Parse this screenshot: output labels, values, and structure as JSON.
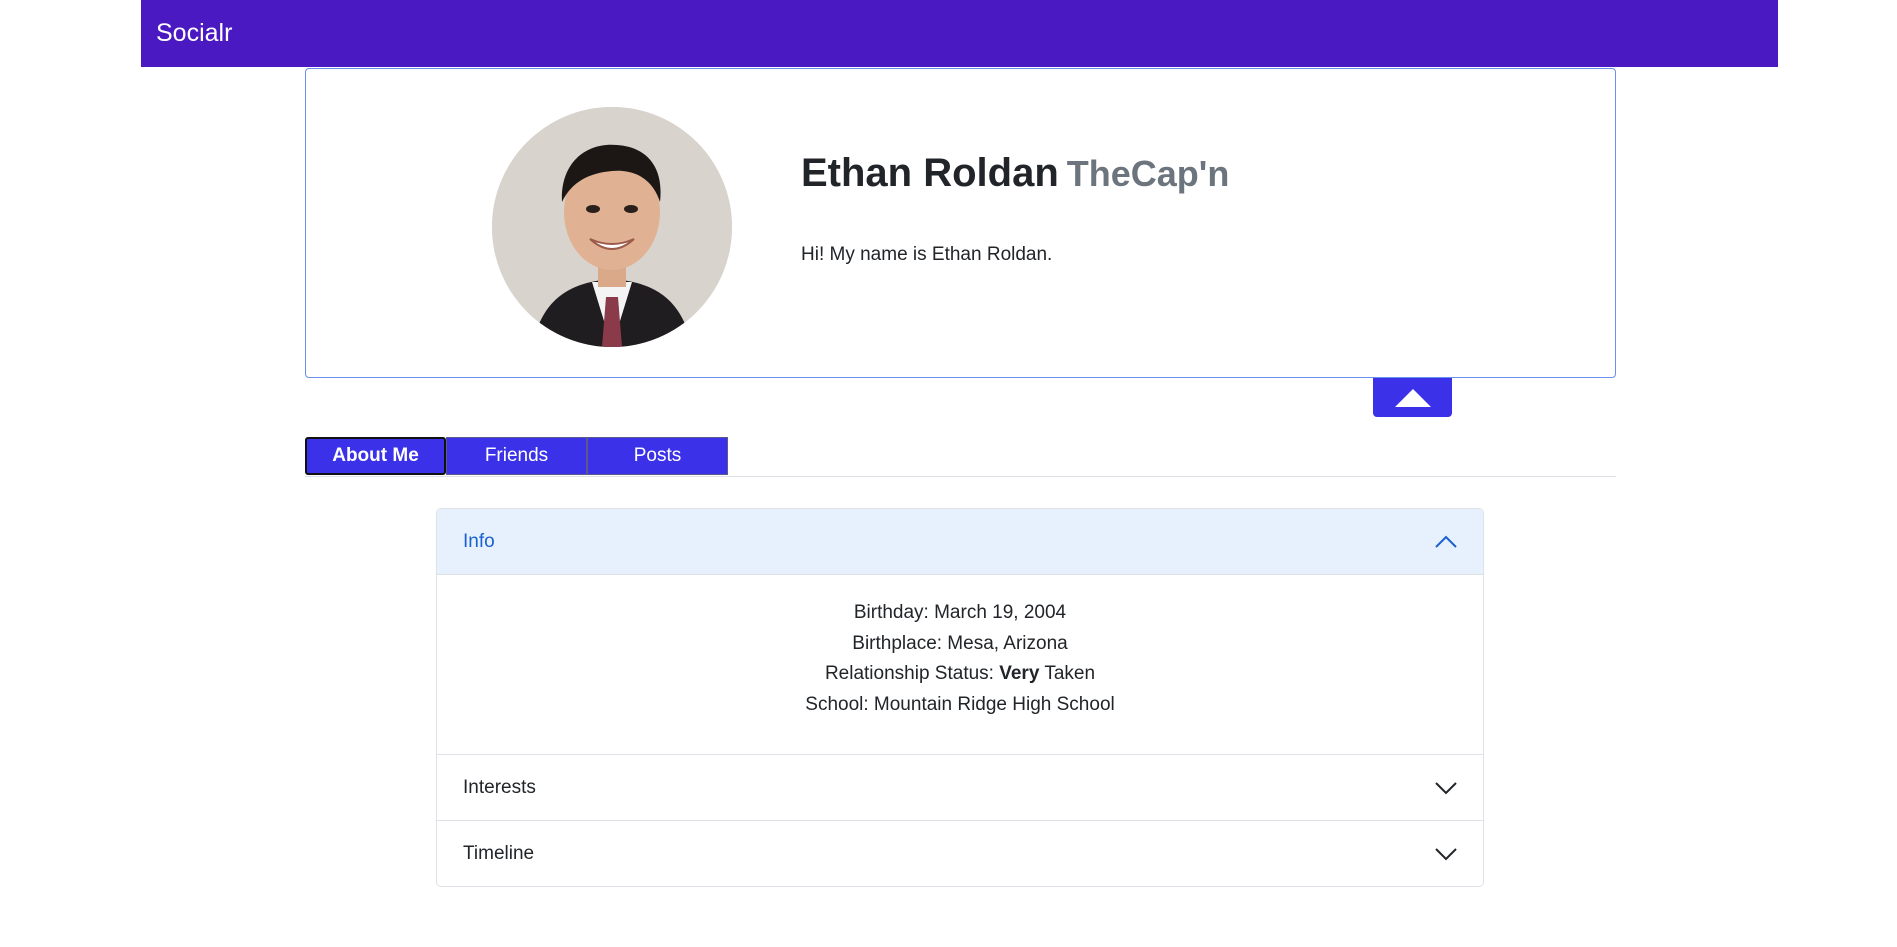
{
  "navbar": {
    "brand": "Socialr"
  },
  "profile": {
    "full_name": "Ethan Roldan",
    "nickname": "TheCap'n",
    "bio": "Hi! My name is Ethan Roldan."
  },
  "tabs": [
    {
      "label": "About Me",
      "active": true
    },
    {
      "label": "Friends",
      "active": false
    },
    {
      "label": "Posts",
      "active": false
    }
  ],
  "accordion": {
    "info": {
      "title": "Info",
      "birthday": "Birthday: March 19, 2004",
      "birthplace": "Birthplace: Mesa, Arizona",
      "relationship_prefix": "Relationship Status:",
      "relationship_emphasis": "Very",
      "relationship_suffix": "Taken",
      "school": "School: Mountain Ridge High School"
    },
    "interests": {
      "title": "Interests"
    },
    "timeline": {
      "title": "Timeline"
    }
  },
  "colors": {
    "navbar": "#4a19c2",
    "accent_button": "#3b31e8",
    "accordion_open_bg": "#e7f1fd",
    "accordion_open_text": "#1a60d2",
    "card_border": "#6b8ef0"
  }
}
